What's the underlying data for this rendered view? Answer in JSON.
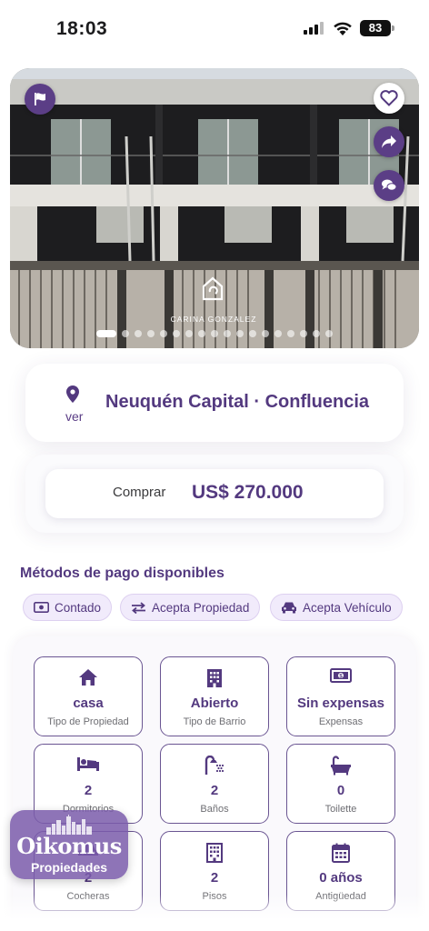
{
  "status_bar": {
    "time": "18:03",
    "battery": "83"
  },
  "hero": {
    "watermark": "CARINA GONZALEZ",
    "slide_count": 18,
    "active_slide": 1,
    "icons": {
      "report": "flag-icon",
      "favorite": "heart-icon",
      "share": "share-icon",
      "chat": "chat-icon"
    }
  },
  "location": {
    "map_link": "ver",
    "place": "Neuquén Capital · Confluencia"
  },
  "price": {
    "operation": "Comprar",
    "amount": "US$ 270.000"
  },
  "payment": {
    "title": "Métodos de pago disponibles",
    "methods": [
      {
        "label": "Contado",
        "icon": "cash-icon"
      },
      {
        "label": "Acepta Propiedad",
        "icon": "swap-icon"
      },
      {
        "label": "Acepta Vehículo",
        "icon": "car-icon"
      }
    ]
  },
  "features": [
    {
      "value": "casa",
      "label": "Tipo de Propiedad",
      "icon": "home-icon"
    },
    {
      "value": "Abierto",
      "label": "Tipo de Barrio",
      "icon": "building-icon"
    },
    {
      "value": "Sin expensas",
      "label": "Expensas",
      "icon": "money-icon"
    },
    {
      "value": "2",
      "label": "Dormitorios",
      "icon": "bed-icon"
    },
    {
      "value": "2",
      "label": "Baños",
      "icon": "shower-icon"
    },
    {
      "value": "0",
      "label": "Toilette",
      "icon": "bathtub-icon"
    },
    {
      "value": "2",
      "label": "Cocheras",
      "icon": "car-icon"
    },
    {
      "value": "2",
      "label": "Pisos",
      "icon": "building-icon"
    },
    {
      "value": "0 años",
      "label": "Antigüedad",
      "icon": "calendar-icon"
    }
  ],
  "brand": {
    "name": "Oikomus",
    "subtitle": "Propiedades"
  },
  "colors": {
    "primary": "#53397f",
    "chip_bg": "#f1ebfb",
    "border": "#6a5592"
  }
}
